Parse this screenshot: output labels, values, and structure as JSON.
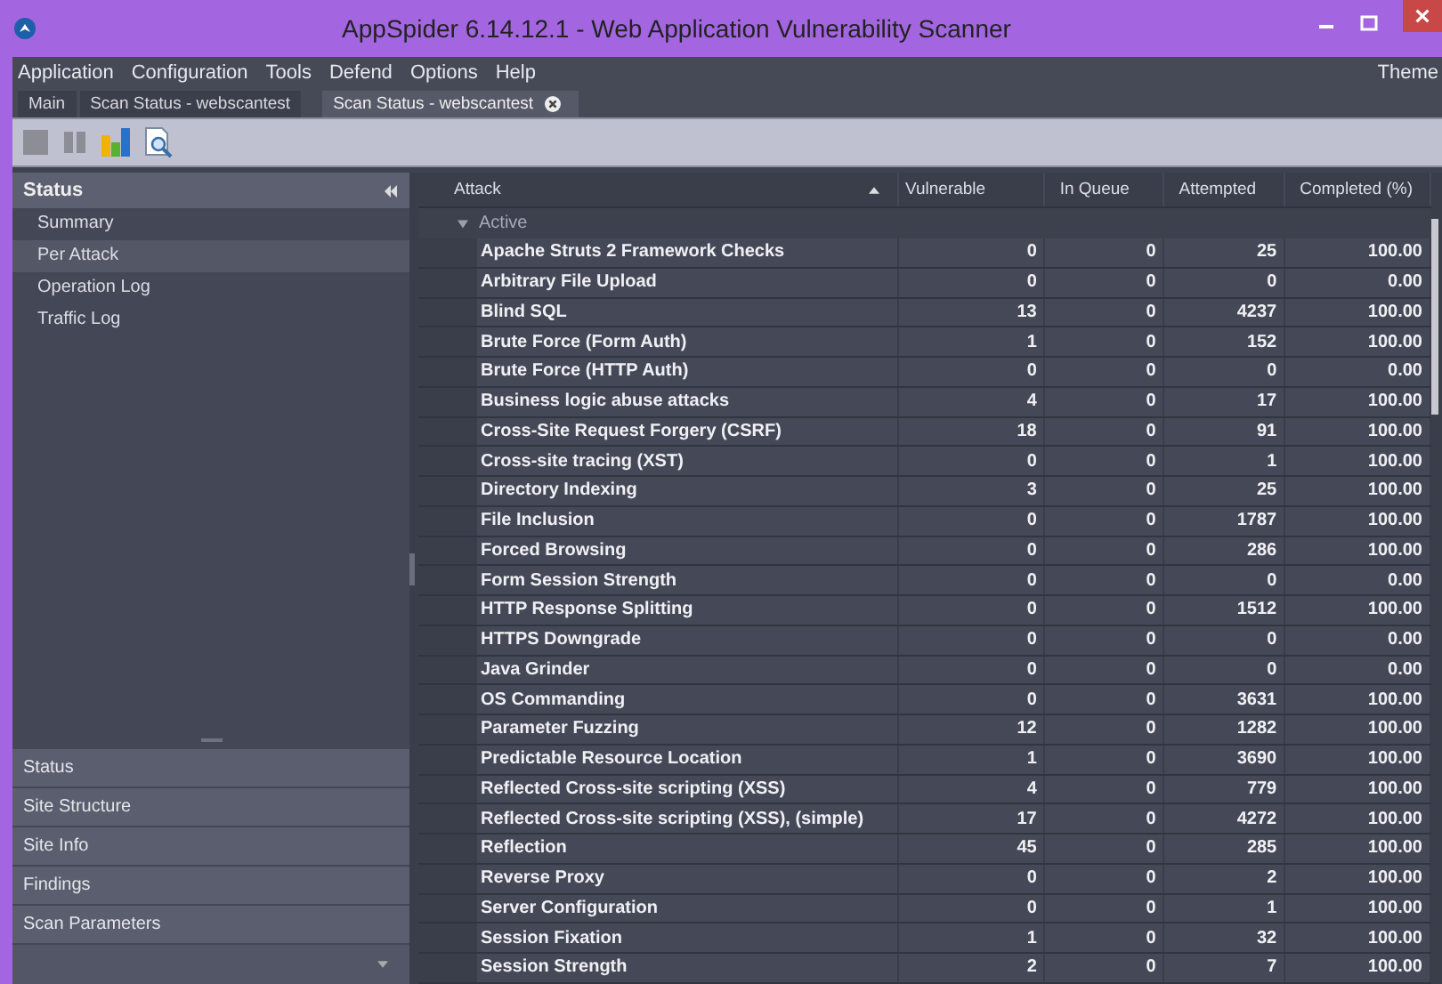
{
  "window": {
    "title": "AppSpider 6.14.12.1 - Web Application Vulnerability Scanner"
  },
  "menu": [
    "Application",
    "Configuration",
    "Tools",
    "Defend",
    "Options",
    "Help"
  ],
  "menu_right": "Theme",
  "tabs": [
    {
      "label": "Main",
      "selected": false,
      "closable": false
    },
    {
      "label": "Scan Status - webscantest",
      "selected": false,
      "closable": false
    },
    {
      "label": "Scan Status - webscantest",
      "selected": true,
      "closable": true
    }
  ],
  "toolbar": [
    {
      "kind": "stop",
      "disabled": true
    },
    {
      "kind": "pause",
      "disabled": true
    },
    {
      "kind": "chart",
      "disabled": false
    },
    {
      "kind": "report",
      "disabled": false
    }
  ],
  "sidebar": {
    "header": "Status",
    "items": [
      {
        "label": "Summary",
        "selected": false
      },
      {
        "label": "Per Attack",
        "selected": true
      },
      {
        "label": "Operation Log",
        "selected": false
      },
      {
        "label": "Traffic Log",
        "selected": false
      }
    ],
    "sections": [
      "Status",
      "Site Structure",
      "Site Info",
      "Findings",
      "Scan Parameters"
    ]
  },
  "table": {
    "columns": [
      {
        "label": "Attack",
        "sorted": true
      },
      {
        "label": "Vulnerable",
        "sorted": false
      },
      {
        "label": "In Queue",
        "sorted": false
      },
      {
        "label": "Attempted",
        "sorted": false
      },
      {
        "label": "Completed (%)",
        "sorted": false
      }
    ],
    "groups": [
      {
        "label": "Active",
        "expanded": true,
        "rows": [
          [
            "Apache Struts 2 Framework Checks",
            "0",
            "0",
            "25",
            "100.00"
          ],
          [
            "Arbitrary File Upload",
            "0",
            "0",
            "0",
            "0.00"
          ],
          [
            "Blind SQL",
            "13",
            "0",
            "4237",
            "100.00"
          ],
          [
            "Brute Force (Form Auth)",
            "1",
            "0",
            "152",
            "100.00"
          ],
          [
            "Brute Force (HTTP Auth)",
            "0",
            "0",
            "0",
            "0.00"
          ],
          [
            "Business logic abuse attacks",
            "4",
            "0",
            "17",
            "100.00"
          ],
          [
            "Cross-Site Request Forgery (CSRF)",
            "18",
            "0",
            "91",
            "100.00"
          ],
          [
            "Cross-site tracing (XST)",
            "0",
            "0",
            "1",
            "100.00"
          ],
          [
            "Directory Indexing",
            "3",
            "0",
            "25",
            "100.00"
          ],
          [
            "File Inclusion",
            "0",
            "0",
            "1787",
            "100.00"
          ],
          [
            "Forced Browsing",
            "0",
            "0",
            "286",
            "100.00"
          ],
          [
            "Form Session Strength",
            "0",
            "0",
            "0",
            "0.00"
          ],
          [
            "HTTP Response Splitting",
            "0",
            "0",
            "1512",
            "100.00"
          ],
          [
            "HTTPS Downgrade",
            "0",
            "0",
            "0",
            "0.00"
          ],
          [
            "Java Grinder",
            "0",
            "0",
            "0",
            "0.00"
          ],
          [
            "OS Commanding",
            "0",
            "0",
            "3631",
            "100.00"
          ],
          [
            "Parameter Fuzzing",
            "12",
            "0",
            "1282",
            "100.00"
          ],
          [
            "Predictable Resource Location",
            "1",
            "0",
            "3690",
            "100.00"
          ],
          [
            "Reflected Cross-site scripting (XSS)",
            "4",
            "0",
            "779",
            "100.00"
          ],
          [
            "Reflected Cross-site scripting (XSS), (simple)",
            "17",
            "0",
            "4272",
            "100.00"
          ],
          [
            "Reflection",
            "45",
            "0",
            "285",
            "100.00"
          ],
          [
            "Reverse Proxy",
            "0",
            "0",
            "2",
            "100.00"
          ],
          [
            "Server Configuration",
            "0",
            "0",
            "1",
            "100.00"
          ],
          [
            "Session Fixation",
            "1",
            "0",
            "32",
            "100.00"
          ],
          [
            "Session Strength",
            "2",
            "0",
            "7",
            "100.00"
          ]
        ]
      }
    ]
  }
}
